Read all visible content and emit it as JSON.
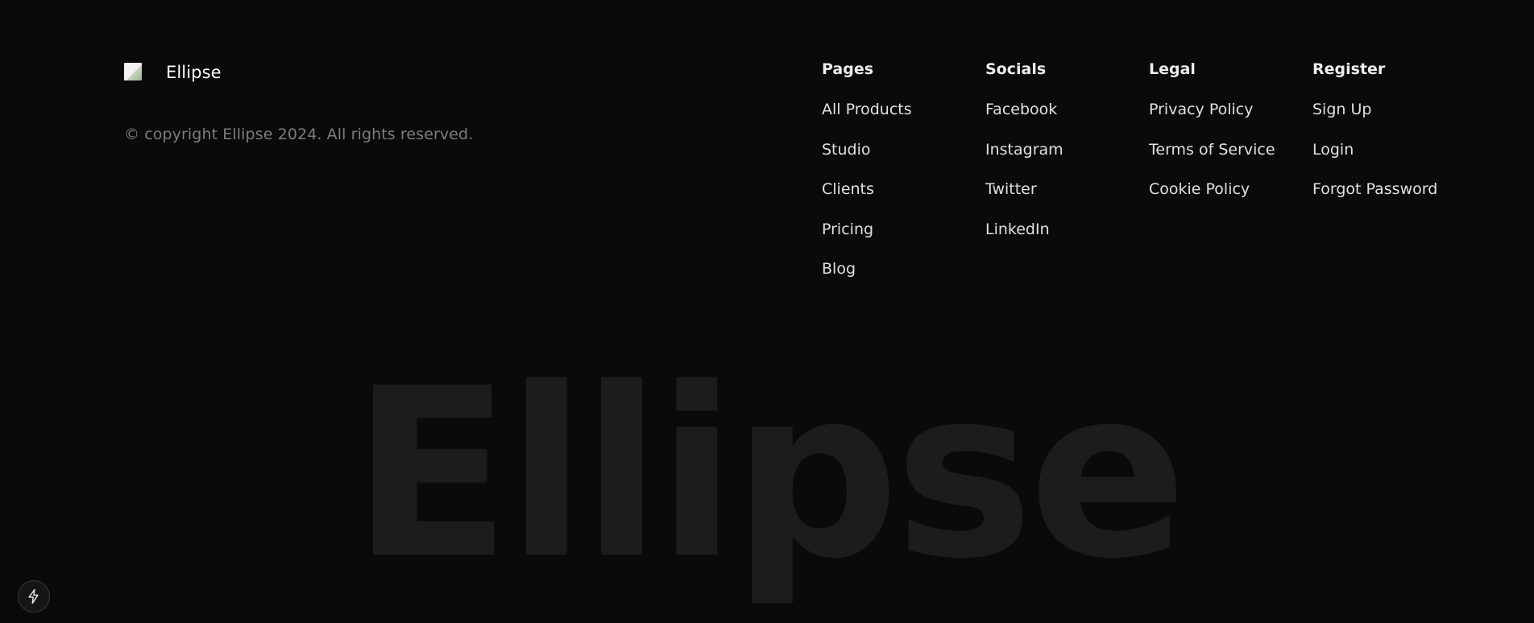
{
  "brand": {
    "name": "Ellipse",
    "copyright": "© copyright Ellipse 2024. All rights reserved."
  },
  "columns": [
    {
      "title": "Pages",
      "links": [
        "All Products",
        "Studio",
        "Clients",
        "Pricing",
        "Blog"
      ]
    },
    {
      "title": "Socials",
      "links": [
        "Facebook",
        "Instagram",
        "Twitter",
        "LinkedIn"
      ]
    },
    {
      "title": "Legal",
      "links": [
        "Privacy Policy",
        "Terms of Service",
        "Cookie Policy"
      ]
    },
    {
      "title": "Register",
      "links": [
        "Sign Up",
        "Login",
        "Forgot Password"
      ]
    }
  ],
  "watermark": "Ellipse",
  "icons": {
    "logo": "broken-image-icon",
    "dev_badge": "lightning-bolt-icon"
  },
  "colors": {
    "background": "#0a0a0a",
    "text": "#e0e0e0",
    "muted": "#7d7d7d",
    "watermark": "#1c1c1c"
  }
}
